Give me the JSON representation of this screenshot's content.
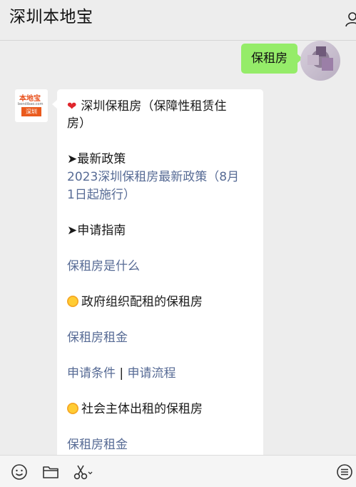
{
  "header": {
    "title": "深圳本地宝"
  },
  "my_message": {
    "text": "保租房"
  },
  "sender": {
    "logo_top": "本地宝",
    "logo_domain": "bendibao.com",
    "logo_city": "深圳"
  },
  "article": {
    "title_line1": "深圳保租房（保障性租赁住",
    "title_line2": "房）",
    "section1_heading": "➤最新政策",
    "policy_link_line1": "2023深圳保租房最新政策（8月",
    "policy_link_line2": "1日起施行）",
    "section2_heading": "➤申请指南",
    "link_what_is": "保租房是什么",
    "section3_heading": "政府组织配租的保租房",
    "link_rent1": "保租房租金",
    "link_conditions": "申请条件",
    "separator": "|",
    "link_process": "申请流程",
    "section4_heading": "社会主体出租的保租房",
    "link_rent2": "保租房租金"
  },
  "footer_icons": [
    "emoji-icon",
    "folder-icon",
    "scissors-icon",
    "menu-icon"
  ]
}
